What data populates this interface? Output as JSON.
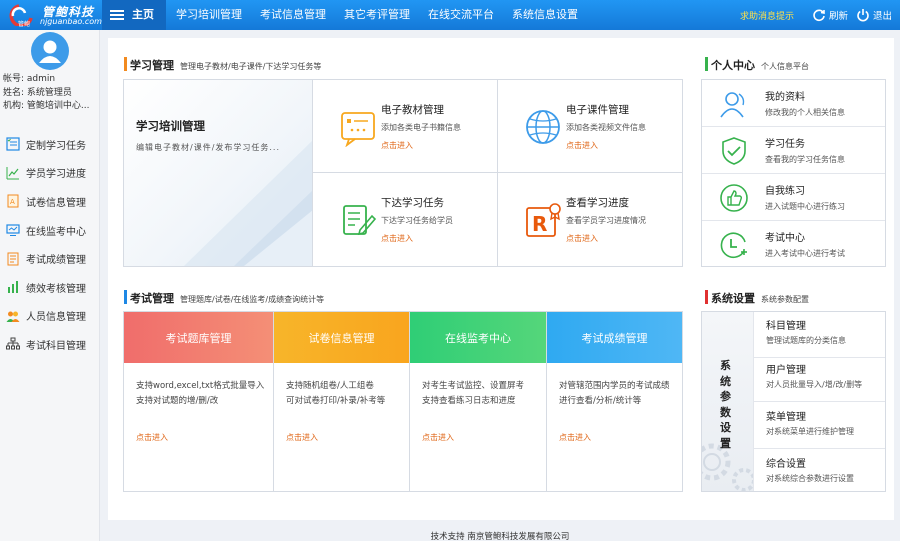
{
  "header": {
    "logo_name": "管鲍科技",
    "logo_url": "njguanbao.com",
    "logo_small": "管鲍",
    "nav": [
      {
        "label": "主页"
      },
      {
        "label": "学习培训管理"
      },
      {
        "label": "考试信息管理"
      },
      {
        "label": "其它考评管理"
      },
      {
        "label": "在线交流平台"
      },
      {
        "label": "系统信息设置"
      }
    ],
    "help_label": "求助消息提示",
    "refresh_label": "刷新",
    "logout_label": "退出"
  },
  "user": {
    "account": "帐号: admin",
    "name": "姓名: 系统管理员",
    "org": "机构: 管鲍培训中心..."
  },
  "sidebar": {
    "items": [
      {
        "label": "定制学习任务",
        "icon": "task-list-icon"
      },
      {
        "label": "学员学习进度",
        "icon": "progress-chart-icon"
      },
      {
        "label": "试卷信息管理",
        "icon": "exam-paper-icon"
      },
      {
        "label": "在线监考中心",
        "icon": "monitor-icon"
      },
      {
        "label": "考试成绩管理",
        "icon": "score-sheet-icon"
      },
      {
        "label": "绩效考核管理",
        "icon": "bar-chart-icon"
      },
      {
        "label": "人员信息管理",
        "icon": "users-icon"
      },
      {
        "label": "考试科目管理",
        "icon": "hierarchy-icon"
      }
    ]
  },
  "learning": {
    "title": "学习管理",
    "subtitle": "管理电子教材/电子课件/下达学习任务等",
    "banner_title": "学习培训管理",
    "banner_desc": "编辑电子教材/课件/发布学习任务...",
    "cards": [
      {
        "title": "电子教材管理",
        "desc": "添加各类电子书籍信息",
        "link": "点击进入"
      },
      {
        "title": "电子课件管理",
        "desc": "添加各类视频文件信息",
        "link": "点击进入"
      },
      {
        "title": "下达学习任务",
        "desc": "下达学习任务给学员",
        "link": "点击进入"
      },
      {
        "title": "查看学习进度",
        "desc": "查看学员学习进度情况",
        "link": "点击进入"
      }
    ]
  },
  "exam": {
    "title": "考试管理",
    "subtitle": "管理题库/试卷/在线监考/成绩查询统计等",
    "columns": [
      {
        "title": "考试题库管理",
        "line1": "支持word,excel,txt格式批量导入",
        "line2": "支持对试题的增/删/改",
        "link": "点击进入",
        "color_from": "#f06d6b",
        "color_to": "#f48f76"
      },
      {
        "title": "试卷信息管理",
        "line1": "支持随机组卷/人工组卷",
        "line2": "可对试卷打印/补录/补考等",
        "link": "点击进入",
        "color_from": "#f7b52a",
        "color_to": "#f9a51e"
      },
      {
        "title": "在线监考中心",
        "line1": "对考生考试监控、设置屏考",
        "line2": "支持查看练习日志和进度",
        "link": "点击进入",
        "color_from": "#2fce76",
        "color_to": "#55d67a"
      },
      {
        "title": "考试成绩管理",
        "line1": "对管辖范围内学员的考试成绩",
        "line2": "进行查看/分析/统计等",
        "link": "点击进入",
        "color_from": "#2fa9f1",
        "color_to": "#4fb7f5"
      }
    ]
  },
  "personal": {
    "title": "个人中心",
    "subtitle": "个人信息平台",
    "items": [
      {
        "title": "我的资料",
        "desc": "修改我的个人相关信息"
      },
      {
        "title": "学习任务",
        "desc": "查看我的学习任务信息"
      },
      {
        "title": "自我练习",
        "desc": "进入试题中心进行练习"
      },
      {
        "title": "考试中心",
        "desc": "进入考试中心进行考试"
      }
    ]
  },
  "system": {
    "title": "系统设置",
    "subtitle": "系统参数配置",
    "banner": "系统参数设置",
    "items": [
      {
        "title": "科目管理",
        "desc": "管理试题库的分类信息"
      },
      {
        "title": "用户管理",
        "desc": "对人员批量导入/增/改/删等"
      },
      {
        "title": "菜单管理",
        "desc": "对系统菜单进行维护管理"
      },
      {
        "title": "综合设置",
        "desc": "对系统综合参数进行设置"
      }
    ]
  },
  "footer": "技术支持  南京管鲍科技发展有限公司",
  "colors": {
    "accent_orange": "#f28a1f",
    "accent_blue": "#1e88e5",
    "accent_green": "#37b24d",
    "accent_red": "#e03131",
    "link_orange": "#e0681a"
  }
}
